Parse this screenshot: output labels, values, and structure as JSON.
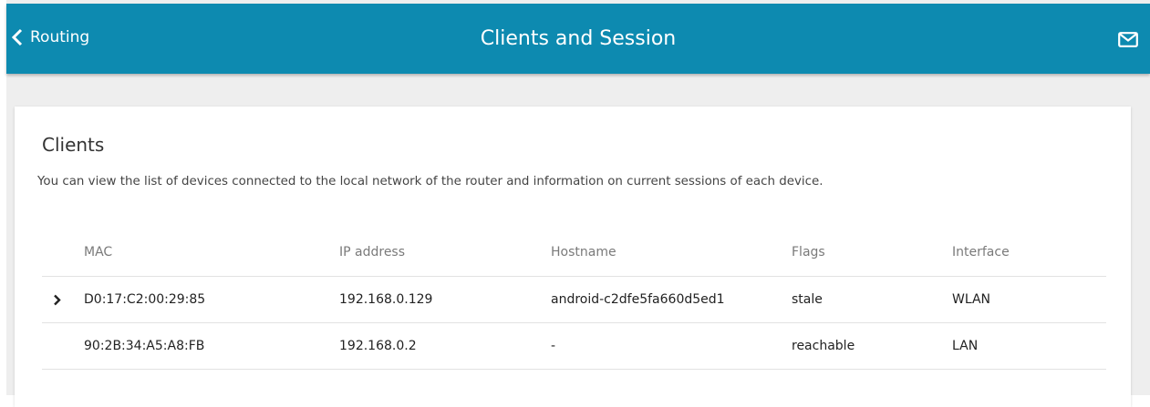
{
  "header": {
    "back_label": "Routing",
    "title": "Clients and Session",
    "mail_icon": "mail-icon",
    "back_icon": "chevron-left-icon",
    "color": "#0d8ab0"
  },
  "clients": {
    "title": "Clients",
    "description": "You can view the list of devices connected to the local network of the router and information on current sessions of each device.",
    "columns": [
      "MAC",
      "IP address",
      "Hostname",
      "Flags",
      "Interface"
    ],
    "rows": [
      {
        "expand_icon": "chevron-right-icon",
        "mac": "D0:17:C2:00:29:85",
        "ip": "192.168.0.129",
        "hostname": "android-c2dfe5fa660d5ed1",
        "flags": "stale",
        "interface": "WLAN"
      },
      {
        "mac": "90:2B:34:A5:A8:FB",
        "ip": "192.168.0.2",
        "hostname": "-",
        "flags": "reachable",
        "interface": "LAN"
      }
    ]
  }
}
